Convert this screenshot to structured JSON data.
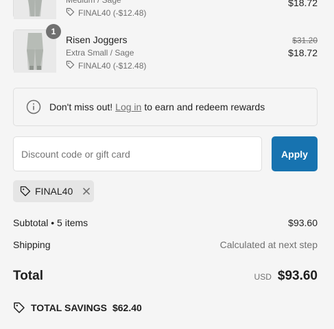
{
  "items": [
    {
      "variant": "Medium / Sage",
      "discount": "FINAL40 (-$12.48)",
      "price": "$18.72"
    },
    {
      "quantity": "1",
      "name": "Risen Joggers",
      "variant": "Extra Small / Sage",
      "discount": "FINAL40 (-$12.48)",
      "original_price": "$31.20",
      "price": "$18.72"
    }
  ],
  "login_notice": {
    "prefix": "Don't miss out!",
    "link": "Log in",
    "suffix": "to earn and redeem rewards"
  },
  "discount_form": {
    "placeholder": "Discount code or gift card",
    "apply_label": "Apply"
  },
  "applied_code": "FINAL40",
  "summary": {
    "subtotal_label": "Subtotal • 5 items",
    "subtotal_value": "$93.60",
    "shipping_label": "Shipping",
    "shipping_value": "Calculated at next step",
    "total_label": "Total",
    "currency": "USD",
    "total_value": "$93.60",
    "savings_label": "TOTAL SAVINGS",
    "savings_value": "$62.40"
  },
  "colors": {
    "accent": "#1773b0",
    "text": "#1f1f1f",
    "muted": "#707070"
  },
  "icons": [
    "info-icon",
    "tag-icon",
    "close-icon",
    "savings-tag-icon"
  ]
}
